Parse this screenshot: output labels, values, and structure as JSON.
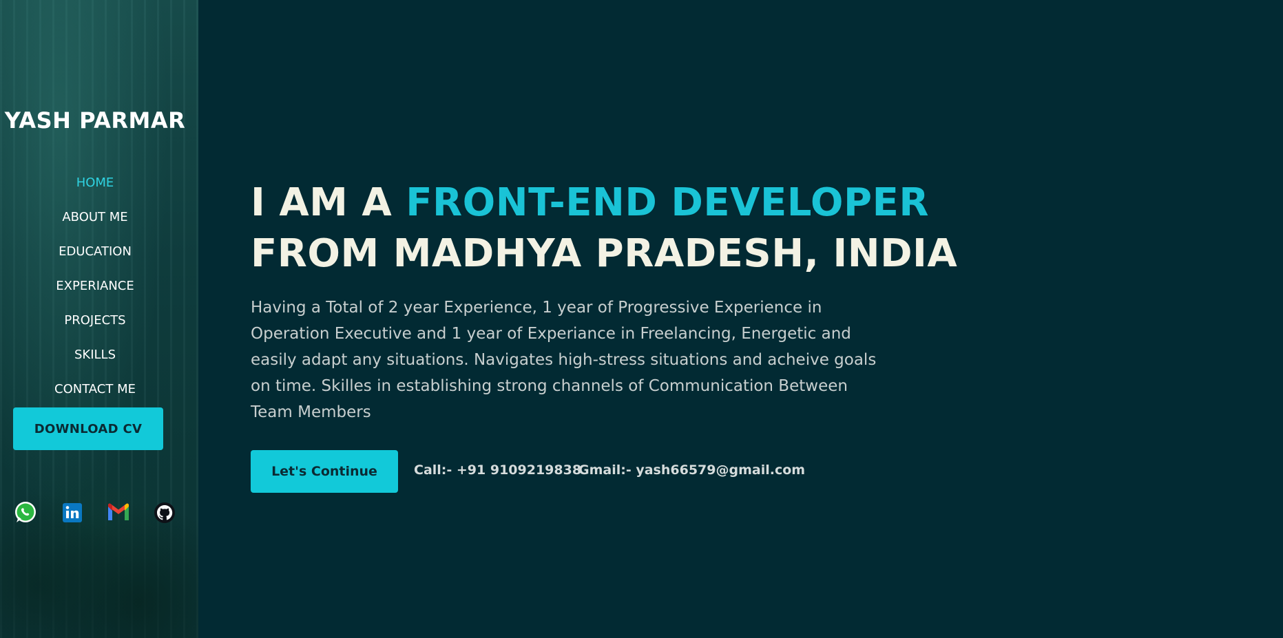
{
  "sidebar": {
    "brand": "YASH PARMAR",
    "nav": [
      {
        "label": "HOME",
        "active": true
      },
      {
        "label": "ABOUT ME",
        "active": false
      },
      {
        "label": "EDUCATION",
        "active": false
      },
      {
        "label": "EXPERIANCE",
        "active": false
      },
      {
        "label": "PROJECTS",
        "active": false
      },
      {
        "label": "SKILLS",
        "active": false
      },
      {
        "label": "CONTACT ME",
        "active": false
      }
    ],
    "download_cv_label": "DOWNLOAD CV",
    "socials": [
      {
        "icon": "whatsapp-icon"
      },
      {
        "icon": "linkedin-icon"
      },
      {
        "icon": "gmail-icon"
      },
      {
        "icon": "github-icon"
      }
    ]
  },
  "hero": {
    "line1_prefix": "I AM A ",
    "line1_accent": "FRONT-END DEVELOPER",
    "line2": "FROM MADHYA PRADESH, INDIA",
    "description": "Having a Total of 2 year Experience, 1 year of Progressive Experience in Operation Executive and 1 year of Experiance in Freelancing, Energetic and easily adapt any situations. Navigates high-stress situations and acheive goals on time. Skilles in establishing strong channels of Communication Between Team Members",
    "continue_label": "Let's Continue",
    "call": "Call:- +91 9109219838",
    "gmail": "Gmail:- yash66579@gmail.com"
  },
  "colors": {
    "background": "#022a33",
    "accent": "#12c9d9",
    "headline": "#f3f2e4"
  }
}
